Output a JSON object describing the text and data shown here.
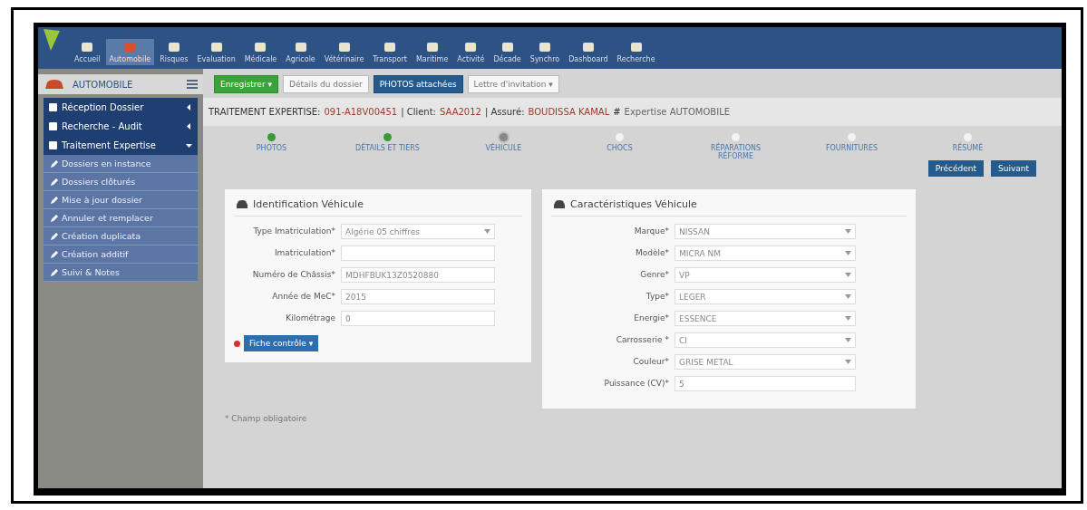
{
  "nav": [
    {
      "label": "Accueil",
      "selected": false
    },
    {
      "label": "Automobile",
      "selected": true
    },
    {
      "label": "Risques",
      "selected": false
    },
    {
      "label": "Evaluation",
      "selected": false
    },
    {
      "label": "Médicale",
      "selected": false
    },
    {
      "label": "Agricole",
      "selected": false
    },
    {
      "label": "Vétérinaire",
      "selected": false
    },
    {
      "label": "Transport",
      "selected": false
    },
    {
      "label": "Maritime",
      "selected": false
    },
    {
      "label": "Activité",
      "selected": false
    },
    {
      "label": "Décade",
      "selected": false
    },
    {
      "label": "Synchro",
      "selected": false
    },
    {
      "label": "Dashboard",
      "selected": false
    },
    {
      "label": "Recherche",
      "selected": false
    }
  ],
  "sidebar": {
    "title": "AUTOMOBILE",
    "items": [
      {
        "label": "Réception Dossier",
        "expanded": false
      },
      {
        "label": "Recherche - Audit",
        "expanded": false
      },
      {
        "label": "Traitement Expertise",
        "expanded": true,
        "children": [
          {
            "label": "Dossiers en instance"
          },
          {
            "label": "Dossiers clôturés"
          },
          {
            "label": "Mise à jour dossier"
          },
          {
            "label": "Annuler et remplacer"
          },
          {
            "label": "Création duplicata"
          },
          {
            "label": "Création additif"
          },
          {
            "label": "Suivi & Notes"
          }
        ]
      }
    ]
  },
  "toolbar": [
    {
      "label": "Enregistrer ▾",
      "kind": "success"
    },
    {
      "label": "Détails du dossier",
      "kind": "plain"
    },
    {
      "label": "PHOTOS attachées",
      "kind": "primary"
    },
    {
      "label": "Lettre d'invitation ▾",
      "kind": "plain"
    }
  ],
  "header": {
    "title": "TRAITEMENT EXPERTISE:",
    "dossier": "091-A18V00451",
    "client_label": "| Client:",
    "client": "SAA2012",
    "assure_label": "| Assuré:",
    "assure": "BOUDISSA KAMAL",
    "hash": "#",
    "type": "Expertise AUTOMOBILE"
  },
  "steps": [
    {
      "label": "PHOTOS",
      "completed": true,
      "selected": false
    },
    {
      "label": "DÉTAILS ET TIERS",
      "completed": true,
      "selected": false
    },
    {
      "label": "VÉHICULE",
      "completed": false,
      "selected": true
    },
    {
      "label": "CHOCS",
      "completed": false,
      "selected": false
    },
    {
      "label": "RÉPARATIONS RÉFORME",
      "completed": false,
      "selected": false
    },
    {
      "label": "FOURNITURES",
      "completed": false,
      "selected": false
    },
    {
      "label": "RÉSUMÉ",
      "completed": false,
      "selected": false
    }
  ],
  "nav_buttons": [
    "Précédent",
    "Suivant"
  ],
  "identification": {
    "title": "Identification Véhicule",
    "fields": [
      {
        "label": "Type Imatriculation*",
        "kind": "select",
        "value": "Algérie 05 chiffres"
      },
      {
        "label": "Imatriculation*",
        "kind": "input"
      },
      {
        "label": "Numéro de Châssis*",
        "kind": "input",
        "value": "MDHFBUK13Z0520880"
      },
      {
        "label": "Année de MeC*",
        "kind": "input",
        "value": "2015"
      },
      {
        "label": "Kilométrage",
        "kind": "input",
        "value": "0"
      }
    ],
    "button": "Fiche contrôle ▾"
  },
  "caracteristiques": {
    "title": "Caractéristiques Véhicule",
    "fields": [
      {
        "label": "Marque*",
        "kind": "select",
        "value": "NISSAN"
      },
      {
        "label": "Modèle*",
        "kind": "select",
        "value": "MICRA NM"
      },
      {
        "label": "Genre*",
        "kind": "select",
        "value": "VP"
      },
      {
        "label": "Type*",
        "kind": "select",
        "value": "LEGER"
      },
      {
        "label": "Energie*",
        "kind": "select",
        "value": "ESSENCE"
      },
      {
        "label": "Carrosserie *",
        "kind": "select",
        "value": "CI"
      },
      {
        "label": "Couleur*",
        "kind": "select",
        "value": "GRISE METAL"
      },
      {
        "label": "Puissance (CV)*",
        "kind": "input",
        "value": "5"
      }
    ]
  },
  "footnote": "* Champ obligatoire"
}
